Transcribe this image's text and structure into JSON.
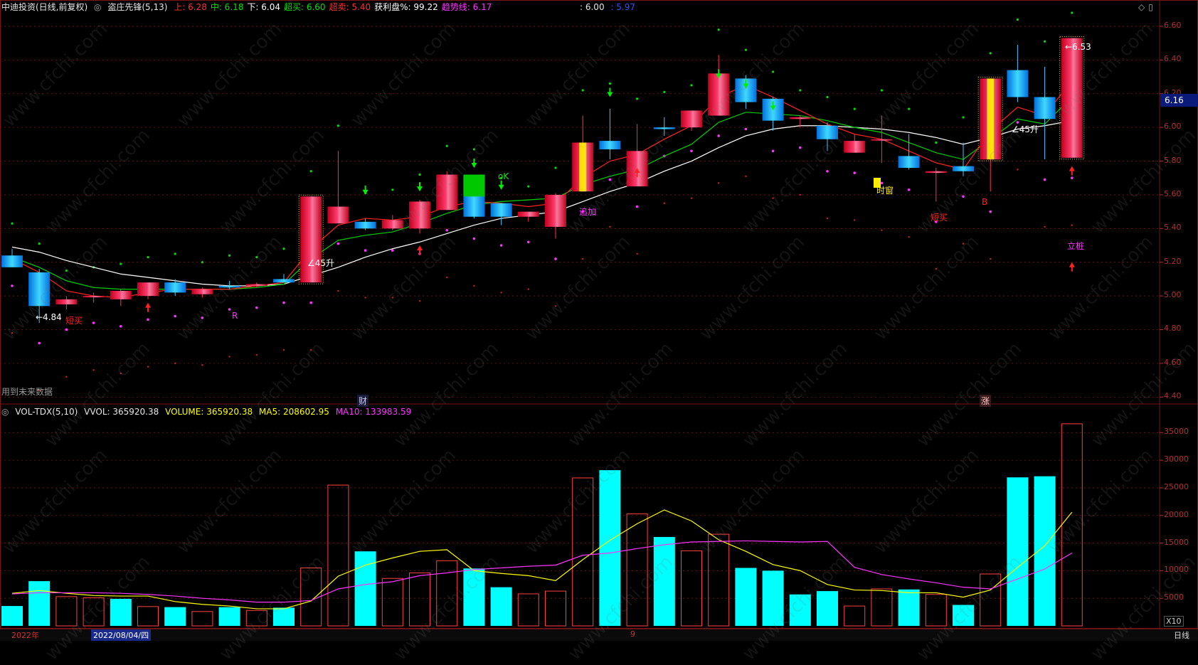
{
  "header": {
    "title": "中迪投资(日线,前复权)",
    "indicator_name": "盗庄先锋(5,13)",
    "items": [
      {
        "label": "上: 6.28",
        "color": "#ff3030"
      },
      {
        "label": "中: 6.18",
        "color": "#00e000"
      },
      {
        "label": "下: 6.04",
        "color": "#ffffff"
      },
      {
        "label": "超买: 6.60",
        "color": "#00e000"
      },
      {
        "label": "超卖: 5.40",
        "color": "#ff3030"
      },
      {
        "label": "获利盘%: 99.22",
        "color": "#ffffff"
      },
      {
        "label": "趋势线: 6.17",
        "color": "#ff33ff"
      }
    ],
    "extra_left": ": 6.00",
    "extra_right": ": 5.97"
  },
  "vol_header": {
    "name": "VOL-TDX(5,10)",
    "vvol": "VVOL: 365920.38",
    "volume": "VOLUME: 365920.38",
    "ma5": "MA5: 208602.95",
    "ma10": "MA10: 133983.59"
  },
  "price_axis": [
    "6.60",
    "6.40",
    "6.20",
    "6.00",
    "5.80",
    "5.60",
    "5.40",
    "5.20",
    "5.00",
    "4.80",
    "4.60",
    "4.40"
  ],
  "current_price": "6.16",
  "vol_axis": [
    "35000",
    "30000",
    "25000",
    "20000",
    "15000",
    "10000",
    "5000"
  ],
  "vol_unit": "X10",
  "labels": {
    "future_data": "用到未来数据",
    "cai": "财",
    "zhang": "涨",
    "low_mark": "←4.84",
    "high_mark": "←6.53",
    "duanmai1": "短买",
    "duanmai2": "短买",
    "zhuijia": "追加",
    "shichuang": "时窗",
    "lizhuang": "立桩",
    "ok": "oK",
    "sheng45a": "∠45升",
    "sheng45b": "∠45升",
    "R": "R",
    "B": "B"
  },
  "bottom": {
    "year": "2022年",
    "date": "2022/08/04/四",
    "mark9": "9",
    "period": "日线"
  },
  "colors": {
    "up_red": "#ff2050",
    "down_cyan": "#00c8ff",
    "vol_up": "#ff4040",
    "vol_down": "#00ffff",
    "ma5": "#ffff00",
    "ma10": "#ff33ff",
    "grid": "#7a1515"
  },
  "chart_data": {
    "type": "candlestick",
    "ylim": [
      4.38,
      6.68
    ],
    "candles": [
      {
        "o": 5.24,
        "h": 5.28,
        "l": 5.18,
        "c": 5.17,
        "up": false
      },
      {
        "o": 5.14,
        "h": 5.16,
        "l": 4.84,
        "c": 4.94,
        "up": false
      },
      {
        "o": 4.95,
        "h": 5.0,
        "l": 4.92,
        "c": 4.98,
        "up": true
      },
      {
        "o": 5.0,
        "h": 5.02,
        "l": 4.96,
        "c": 5.0,
        "up": true
      },
      {
        "o": 4.98,
        "h": 5.04,
        "l": 4.94,
        "c": 5.03,
        "up": true
      },
      {
        "o": 5.0,
        "h": 5.08,
        "l": 4.98,
        "c": 5.08,
        "up": true
      },
      {
        "o": 5.08,
        "h": 5.1,
        "l": 5.0,
        "c": 5.02,
        "up": false
      },
      {
        "o": 5.01,
        "h": 5.05,
        "l": 4.99,
        "c": 5.04,
        "up": true
      },
      {
        "o": 5.06,
        "h": 5.09,
        "l": 5.04,
        "c": 5.05,
        "up": false
      },
      {
        "o": 5.06,
        "h": 5.08,
        "l": 5.05,
        "c": 5.07,
        "up": true
      },
      {
        "o": 5.1,
        "h": 5.13,
        "l": 5.08,
        "c": 5.08,
        "up": false
      },
      {
        "o": 5.08,
        "h": 5.59,
        "l": 5.08,
        "c": 5.59,
        "up": true
      },
      {
        "o": 5.43,
        "h": 5.86,
        "l": 5.43,
        "c": 5.53,
        "up": true
      },
      {
        "o": 5.44,
        "h": 5.46,
        "l": 5.39,
        "c": 5.4,
        "up": false
      },
      {
        "o": 5.4,
        "h": 5.48,
        "l": 5.39,
        "c": 5.45,
        "up": true
      },
      {
        "o": 5.4,
        "h": 5.57,
        "l": 5.37,
        "c": 5.56,
        "up": true
      },
      {
        "o": 5.51,
        "h": 5.74,
        "l": 5.51,
        "c": 5.72,
        "up": true
      },
      {
        "o": 5.71,
        "h": 5.72,
        "l": 5.46,
        "c": 5.47,
        "up": false
      },
      {
        "o": 5.47,
        "h": 5.55,
        "l": 5.42,
        "c": 5.55,
        "up": false
      },
      {
        "o": 5.47,
        "h": 5.5,
        "l": 5.44,
        "c": 5.5,
        "up": true
      },
      {
        "o": 5.41,
        "h": 5.61,
        "l": 5.34,
        "c": 5.6,
        "up": true
      },
      {
        "o": 5.62,
        "h": 6.07,
        "l": 5.62,
        "c": 5.91,
        "up": true
      },
      {
        "o": 5.92,
        "h": 6.11,
        "l": 5.81,
        "c": 5.87,
        "up": false
      },
      {
        "o": 5.65,
        "h": 6.02,
        "l": 5.65,
        "c": 5.86,
        "up": true
      },
      {
        "o": 6.0,
        "h": 6.06,
        "l": 5.95,
        "c": 5.99,
        "up": false
      },
      {
        "o": 6.0,
        "h": 6.1,
        "l": 5.98,
        "c": 6.1,
        "up": true
      },
      {
        "o": 6.07,
        "h": 6.43,
        "l": 6.07,
        "c": 6.32,
        "up": true
      },
      {
        "o": 6.29,
        "h": 6.31,
        "l": 6.11,
        "c": 6.15,
        "up": false
      },
      {
        "o": 6.17,
        "h": 6.18,
        "l": 5.98,
        "c": 6.04,
        "up": false
      },
      {
        "o": 6.05,
        "h": 6.07,
        "l": 6.0,
        "c": 6.06,
        "up": true
      },
      {
        "o": 6.01,
        "h": 6.03,
        "l": 5.86,
        "c": 5.93,
        "up": false
      },
      {
        "o": 5.85,
        "h": 5.96,
        "l": 5.85,
        "c": 5.92,
        "up": true
      },
      {
        "o": 5.93,
        "h": 6.07,
        "l": 5.79,
        "c": 5.93,
        "up": true
      },
      {
        "o": 5.83,
        "h": 5.96,
        "l": 5.75,
        "c": 5.76,
        "up": false
      },
      {
        "o": 5.73,
        "h": 5.76,
        "l": 5.56,
        "c": 5.74,
        "up": true
      },
      {
        "o": 5.77,
        "h": 5.91,
        "l": 5.71,
        "c": 5.74,
        "up": false
      },
      {
        "o": 5.81,
        "h": 6.29,
        "l": 5.62,
        "c": 6.29,
        "up": true
      },
      {
        "o": 6.34,
        "h": 6.49,
        "l": 6.15,
        "c": 6.18,
        "up": false
      },
      {
        "o": 6.05,
        "h": 6.36,
        "l": 5.81,
        "c": 6.18,
        "up": false
      },
      {
        "o": 5.82,
        "h": 6.53,
        "l": 5.82,
        "c": 6.53,
        "up": true
      }
    ],
    "ma_white": [
      5.29,
      5.26,
      5.21,
      5.17,
      5.13,
      5.11,
      5.09,
      5.07,
      5.06,
      5.06,
      5.07,
      5.12,
      5.17,
      5.23,
      5.28,
      5.32,
      5.37,
      5.42,
      5.46,
      5.48,
      5.5,
      5.56,
      5.62,
      5.67,
      5.74,
      5.8,
      5.88,
      5.95,
      5.99,
      6.01,
      6.01,
      6.0,
      5.99,
      5.97,
      5.94,
      5.9,
      5.94,
      5.99,
      6.01,
      6.04
    ],
    "ma_green": [
      5.23,
      5.17,
      5.09,
      5.05,
      5.04,
      5.04,
      5.04,
      5.04,
      5.04,
      5.05,
      5.07,
      5.22,
      5.33,
      5.36,
      5.38,
      5.43,
      5.49,
      5.54,
      5.56,
      5.57,
      5.58,
      5.66,
      5.71,
      5.75,
      5.83,
      5.9,
      6.03,
      6.09,
      6.08,
      6.07,
      6.04,
      6.0,
      5.97,
      5.91,
      5.85,
      5.81,
      5.93,
      6.05,
      6.02,
      6.18
    ],
    "ma_red": [
      5.22,
      5.14,
      5.03,
      5.0,
      4.99,
      5.02,
      5.04,
      5.04,
      5.04,
      5.06,
      5.08,
      5.28,
      5.42,
      5.46,
      5.45,
      5.47,
      5.53,
      5.56,
      5.55,
      5.53,
      5.55,
      5.7,
      5.8,
      5.84,
      5.93,
      6.01,
      6.18,
      6.25,
      6.18,
      6.1,
      6.02,
      5.96,
      5.93,
      5.86,
      5.79,
      5.75,
      5.98,
      6.12,
      6.07,
      6.28
    ],
    "volume": [
      3.6,
      8.1,
      5.3,
      5.1,
      4.9,
      3.5,
      3.4,
      2.6,
      3.4,
      2.8,
      3.3,
      10.5,
      25.5,
      13.5,
      8.6,
      9.6,
      11.8,
      10.4,
      7.0,
      5.8,
      6.3,
      26.8,
      28.2,
      20.3,
      16.1,
      13.6,
      16.6,
      10.5,
      10.0,
      5.7,
      6.3,
      3.6,
      6.7,
      6.6,
      5.7,
      3.8,
      9.4,
      26.9,
      27.1,
      36.6
    ],
    "vol_up": [
      false,
      false,
      true,
      true,
      false,
      true,
      false,
      true,
      false,
      true,
      false,
      true,
      true,
      false,
      true,
      true,
      true,
      false,
      false,
      true,
      true,
      true,
      false,
      true,
      false,
      true,
      true,
      false,
      false,
      false,
      false,
      true,
      true,
      false,
      true,
      false,
      true,
      false,
      false,
      true
    ],
    "vol_ma5": [
      5.9,
      6.4,
      5.9,
      5.5,
      5.4,
      5.4,
      4.4,
      3.9,
      3.6,
      3.1,
      3.1,
      4.5,
      9.0,
      11.0,
      12.3,
      13.5,
      13.8,
      10.0,
      9.5,
      9.1,
      8.2,
      12.0,
      15.5,
      18.5,
      21.0,
      19.0,
      15.6,
      13.5,
      11.1,
      10.0,
      7.5,
      6.5,
      6.4,
      6.0,
      6.0,
      5.2,
      6.5,
      10.6,
      14.5,
      20.6
    ],
    "vol_ma10": [
      5.8,
      6.0,
      6.0,
      6.0,
      5.9,
      5.7,
      5.4,
      5.0,
      4.7,
      4.3,
      4.3,
      4.6,
      6.7,
      7.5,
      8.0,
      9.1,
      9.6,
      10.2,
      10.5,
      10.8,
      11.0,
      12.8,
      13.2,
      14.0,
      14.7,
      15.2,
      15.3,
      15.4,
      15.3,
      15.2,
      15.3,
      10.6,
      9.3,
      8.5,
      7.8,
      7.0,
      6.7,
      8.5,
      10.3,
      13.2
    ],
    "vol_ylim": [
      0,
      38
    ]
  }
}
